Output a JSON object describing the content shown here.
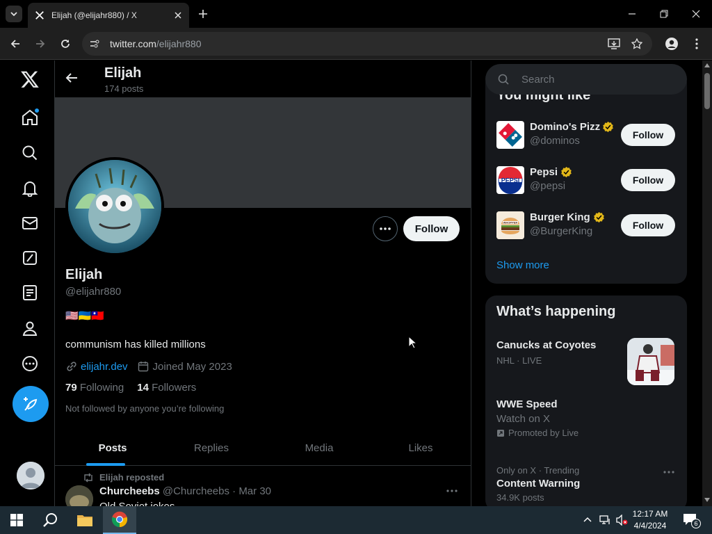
{
  "browser": {
    "tab_title": "Elijah (@elijahr880) / X",
    "url_host": "twitter.com",
    "url_path": "/elijahr880"
  },
  "profile_header": {
    "name": "Elijah",
    "posts_count": "174 posts"
  },
  "profile": {
    "name": "Elijah",
    "handle": "@elijahr880",
    "flags": "🇺🇸🇺🇦🇹🇼",
    "bio": "communism has killed millions",
    "website": "elijahr.dev",
    "joined": "Joined May 2023",
    "following_count": "79",
    "following_label": "Following",
    "followers_count": "14",
    "followers_label": "Followers",
    "not_followed": "Not followed by anyone you’re following",
    "follow_label": "Follow"
  },
  "tabs": [
    "Posts",
    "Replies",
    "Media",
    "Likes"
  ],
  "post": {
    "repost_label": "Elijah reposted",
    "author": "Churcheebs",
    "handle_date": "@Churcheebs · Mar 30",
    "text": "Old Soviet jokes"
  },
  "search": {
    "placeholder": "Search"
  },
  "you_might_like": {
    "title": "You might like",
    "items": [
      {
        "name": "Domino's Pizz",
        "handle": "@dominos",
        "follow": "Follow"
      },
      {
        "name": "Pepsi",
        "handle": "@pepsi",
        "follow": "Follow"
      },
      {
        "name": "Burger King",
        "handle": "@BurgerKing",
        "follow": "Follow"
      }
    ],
    "show_more": "Show more"
  },
  "whats_happening": {
    "title": "What’s happening",
    "items": [
      {
        "title": "Canucks at Coyotes",
        "meta": "NHL · LIVE"
      },
      {
        "title": "WWE Speed",
        "meta": "Watch on X",
        "promo": "Promoted by Live"
      },
      {
        "context": "Only on X · Trending",
        "title": "Content Warning",
        "meta": "34.9K posts"
      }
    ]
  },
  "taskbar": {
    "time": "12:17 AM",
    "date": "4/4/2024",
    "notif_count": "6"
  },
  "colors": {
    "accent": "#1d9bf0",
    "verified": "#e2b719",
    "background": "#000000"
  }
}
